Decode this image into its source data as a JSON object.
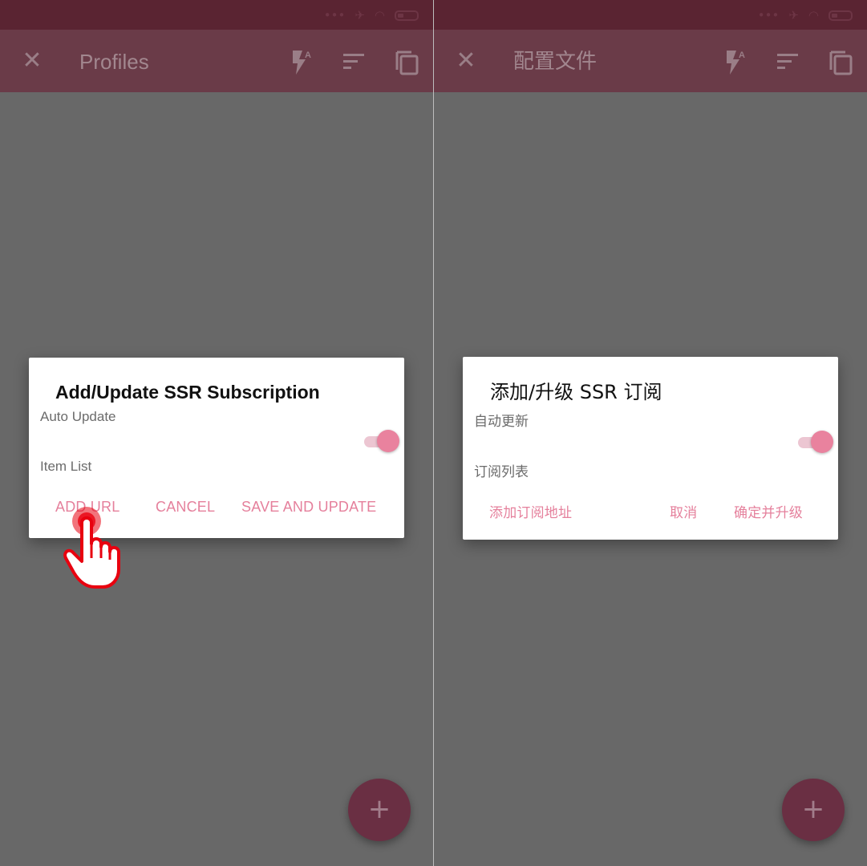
{
  "panels": [
    {
      "title": "Profiles",
      "dialog": {
        "title": "Add/Update SSR Subscription",
        "auto_update_label": "Auto Update",
        "item_list_label": "Item List",
        "auto_update_enabled": true,
        "buttons": {
          "add_url": "ADD URL",
          "cancel": "CANCEL",
          "save": "SAVE AND UPDATE"
        }
      },
      "fab_label": "+"
    },
    {
      "title": "配置文件",
      "dialog": {
        "title": "添加/升级 SSR 订阅",
        "auto_update_label": "自动更新",
        "item_list_label": "订阅列表",
        "auto_update_enabled": true,
        "buttons": {
          "add_url": "添加订阅地址",
          "cancel": "取消",
          "save": "确定并升级"
        }
      },
      "fab_label": "+"
    }
  ],
  "icons": {
    "close": "close-icon",
    "flash": "flash-auto-icon",
    "sort": "sort-icon",
    "copy": "copy-icon",
    "tap": "tap-hand-icon"
  },
  "colors": {
    "accent": "#e5809c",
    "toolbar_dimmed": "#6a3b48",
    "scrim": "#686868",
    "tap_indicator": "#e8000f"
  }
}
